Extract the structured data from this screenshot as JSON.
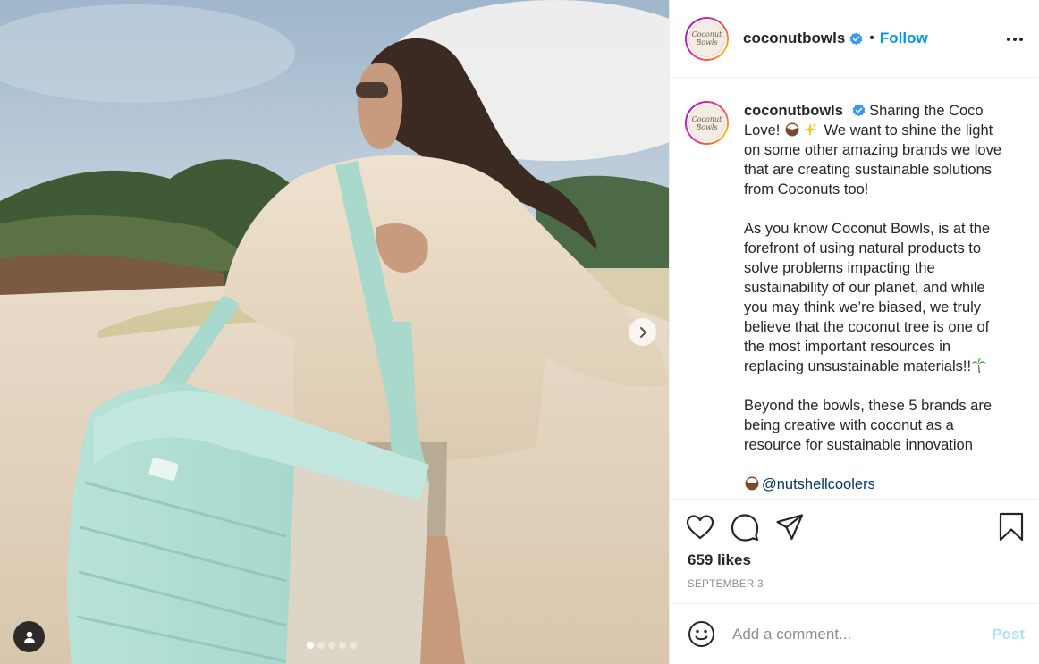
{
  "post": {
    "username": "coconutbowls",
    "logo_text_1": "Coconut",
    "logo_text_2": "Bowls",
    "verified_icon": "verified-badge-icon",
    "separator": "•",
    "follow_label": "Follow",
    "more_icon": "more-options-icon"
  },
  "media": {
    "next_icon": "chevron-right-icon",
    "tag_icon": "user-tag-icon",
    "carousel": {
      "total": 5,
      "active": 1
    }
  },
  "caption": {
    "username": "coconutbowls",
    "p1_text": "Sharing the Coco Love!",
    "p1_text_b": "We want to shine the light on some other amazing brands we love that are creating sustainable solutions from Coconuts too!",
    "p2_text": "As you know Coconut Bowls, is at the forefront of using natural products to solve problems impacting the sustainability of our planet, and while you may think we’re biased, we truly believe that the coconut tree is one of the most important resources in replacing unsustainable materials!!",
    "p3_text": "Beyond the bowls, these 5 brands are being creative with coconut as a resource for sustainable innovation",
    "mention": "@nutshellcoolers",
    "emojis": [
      "coconut-emoji",
      "sparkles-emoji",
      "palm-tree-emoji"
    ]
  },
  "actions": {
    "like_icon": "heart-icon",
    "comment_icon": "comment-icon",
    "share_icon": "share-icon",
    "save_icon": "bookmark-icon",
    "likes_text": "659 likes",
    "date_text": "SEPTEMBER 3"
  },
  "comment_box": {
    "emoji_icon": "smiley-icon",
    "placeholder": "Add a comment...",
    "post_label": "Post"
  },
  "colors": {
    "link_blue": "#0095f6",
    "post_disabled": "#b2dffc",
    "mention": "#00376b",
    "muted": "#8e8e8e"
  }
}
